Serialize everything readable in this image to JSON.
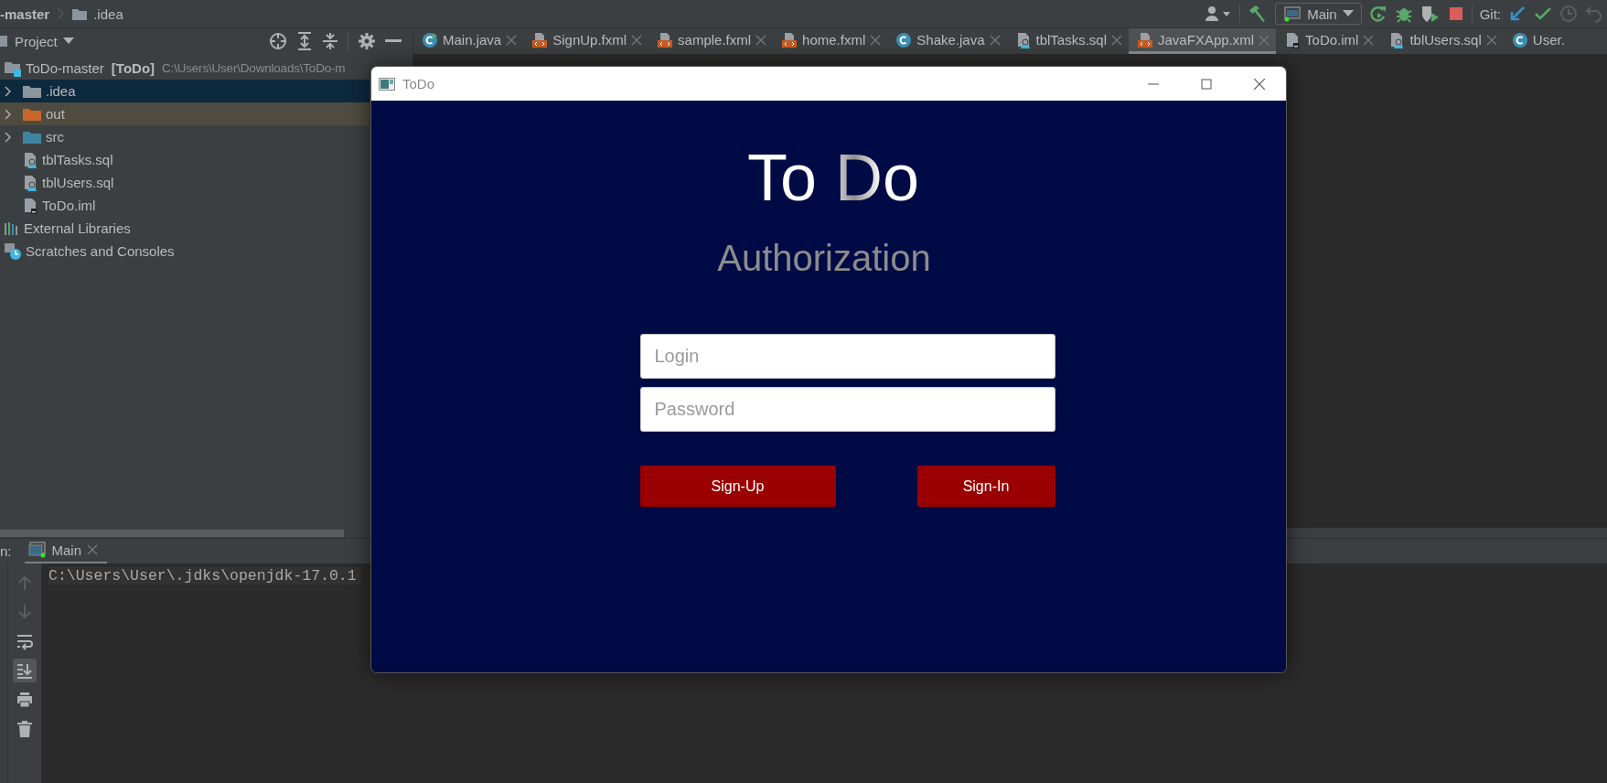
{
  "nav_bar": {
    "breadcrumbs": [
      {
        "label": "-master",
        "kind": "project"
      },
      {
        "label": ".idea",
        "kind": "folder"
      }
    ],
    "run_config": "Main",
    "git_label": "Git:"
  },
  "project_panel": {
    "title": "Project",
    "tree": [
      {
        "kind": "module",
        "name": "ToDo-master",
        "tag": "[ToDo]",
        "path": "C:\\Users\\User\\Downloads\\ToDo-m",
        "selected": false,
        "excluded": false,
        "children": [
          {
            "kind": "folder",
            "name": ".idea",
            "color": "#8c959e",
            "expanded": false,
            "selected": true,
            "excluded": false
          },
          {
            "kind": "folder",
            "name": "out",
            "color": "#c7662b",
            "expanded": false,
            "selected": false,
            "excluded": true
          },
          {
            "kind": "folder",
            "name": "src",
            "color": "#3e86a0",
            "expanded": false,
            "selected": false,
            "excluded": false
          },
          {
            "kind": "sql",
            "name": "tblTasks.sql",
            "selected": false,
            "excluded": false
          },
          {
            "kind": "sql",
            "name": "tblUsers.sql",
            "selected": false,
            "excluded": false
          },
          {
            "kind": "iml",
            "name": "ToDo.iml",
            "selected": false,
            "excluded": false
          }
        ]
      },
      {
        "kind": "libraries",
        "name": "External Libraries",
        "selected": false,
        "excluded": false
      },
      {
        "kind": "scratches",
        "name": "Scratches and Consoles",
        "selected": false,
        "excluded": false
      }
    ]
  },
  "editor_tabs": [
    {
      "label": "Main.java",
      "kind": "main",
      "selected": false
    },
    {
      "label": "SignUp.fxml",
      "kind": "fxml",
      "selected": false
    },
    {
      "label": "sample.fxml",
      "kind": "fxml",
      "selected": false
    },
    {
      "label": "home.fxml",
      "kind": "fxml",
      "selected": false
    },
    {
      "label": "Shake.java",
      "kind": "class",
      "selected": false
    },
    {
      "label": "tblTasks.sql",
      "kind": "sql",
      "selected": false
    },
    {
      "label": "JavaFXApp.xml",
      "kind": "xml",
      "selected": true
    },
    {
      "label": "ToDo.iml",
      "kind": "iml",
      "selected": false
    },
    {
      "label": "tblUsers.sql",
      "kind": "sql",
      "selected": false
    },
    {
      "label": "User.",
      "kind": "class",
      "selected": false
    }
  ],
  "run_panel": {
    "label": "n:",
    "tabs": [
      {
        "label": "Main",
        "selected": true
      }
    ],
    "tools": [
      {
        "kind": "up",
        "disabled": true,
        "toggled": false
      },
      {
        "kind": "down",
        "disabled": true,
        "toggled": false
      },
      {
        "kind": "wrap",
        "disabled": false,
        "toggled": false
      },
      {
        "kind": "scroll-end",
        "disabled": false,
        "toggled": true
      },
      {
        "kind": "print",
        "disabled": false,
        "toggled": false
      },
      {
        "kind": "trash",
        "disabled": false,
        "toggled": false
      }
    ],
    "console_lines": [
      "C:\\Users\\User\\.jdks\\openjdk-17.0.1"
    ]
  },
  "dialog": {
    "title": "ToDo",
    "heading": "To Do",
    "subtitle": "Authorization",
    "fields": [
      {
        "placeholder": "Login"
      },
      {
        "placeholder": "Password"
      }
    ],
    "buttons": [
      "Sign-Up",
      "Sign-In"
    ]
  }
}
